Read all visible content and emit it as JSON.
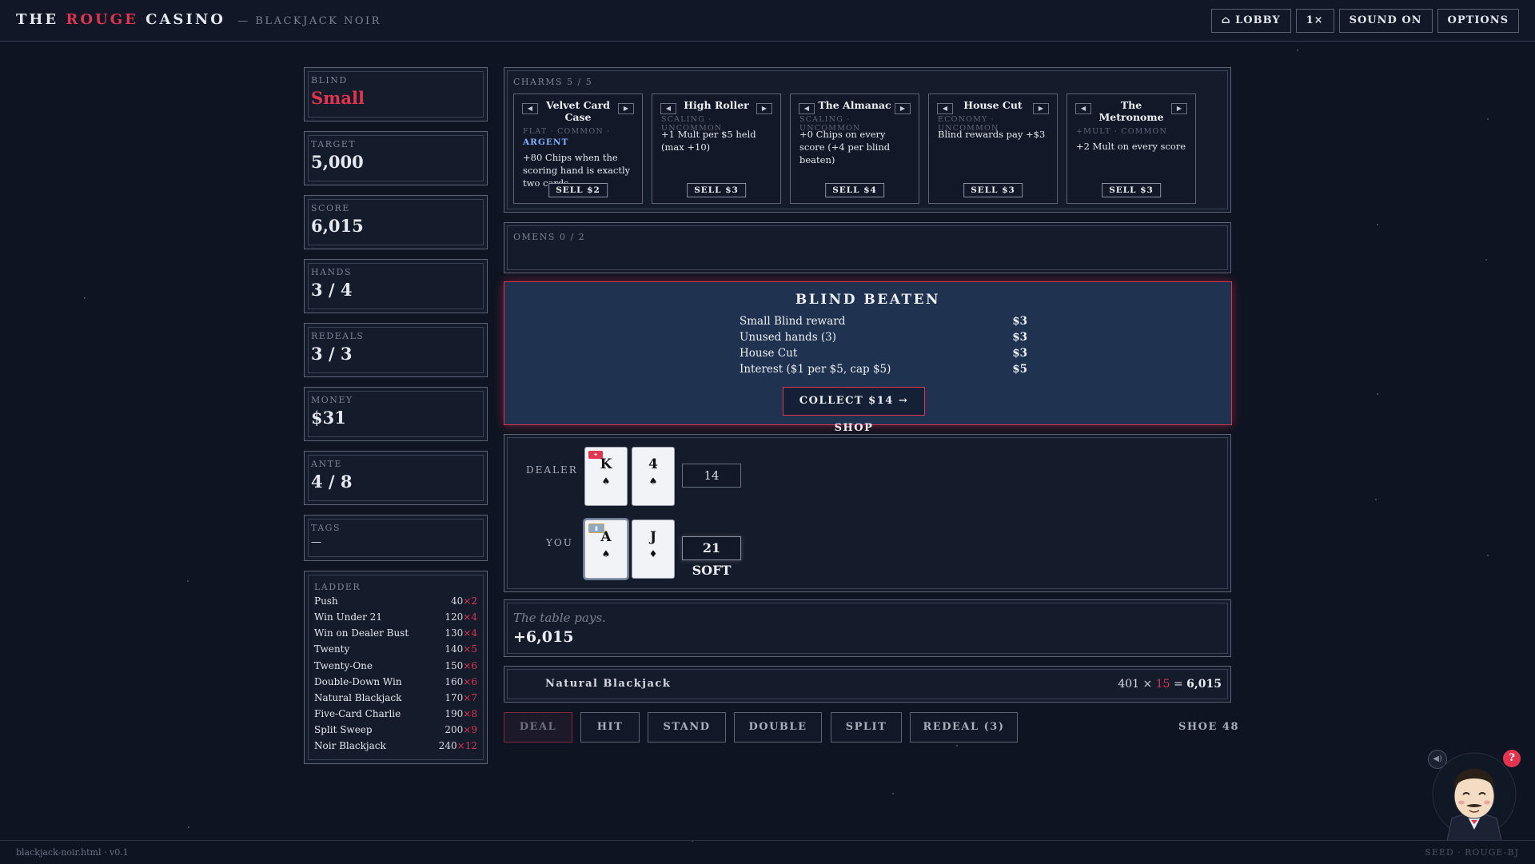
{
  "header": {
    "brand_the": "THE",
    "brand_rouge": "ROUGE",
    "brand_casino": "CASINO",
    "brand_sub": "— BLACKJACK NOIR",
    "buttons": [
      "⌂ LOBBY",
      "1×",
      "SOUND ON",
      "OPTIONS"
    ]
  },
  "stats": [
    {
      "label": "BLIND",
      "value": "Small"
    },
    {
      "label": "TARGET",
      "value": "5,000"
    },
    {
      "label": "SCORE",
      "value": "6,015"
    },
    {
      "label": "HANDS",
      "value": "3 / 4"
    },
    {
      "label": "REDEALS",
      "value": "3 / 3"
    },
    {
      "label": "MONEY",
      "value": "$31"
    },
    {
      "label": "ANTE",
      "value": "4 / 8"
    },
    {
      "label": "TAGS",
      "value": "—"
    }
  ],
  "ladder": {
    "label": "LADDER",
    "rows": [
      {
        "name": "Push",
        "chips": "40",
        "mult": "×2"
      },
      {
        "name": "Win Under 21",
        "chips": "120",
        "mult": "×4"
      },
      {
        "name": "Win on Dealer Bust",
        "chips": "130",
        "mult": "×4"
      },
      {
        "name": "Twenty",
        "chips": "140",
        "mult": "×5"
      },
      {
        "name": "Twenty-One",
        "chips": "150",
        "mult": "×6"
      },
      {
        "name": "Double-Down Win",
        "chips": "160",
        "mult": "×6"
      },
      {
        "name": "Natural Blackjack",
        "chips": "170",
        "mult": "×7"
      },
      {
        "name": "Five-Card Charlie",
        "chips": "190",
        "mult": "×8"
      },
      {
        "name": "Split Sweep",
        "chips": "200",
        "mult": "×9"
      },
      {
        "name": "Noir Blackjack",
        "chips": "240",
        "mult": "×12"
      }
    ]
  },
  "charms": {
    "label": "CHARMS 5 / 5",
    "items": [
      {
        "name": "Velvet Card Case",
        "meta": "FLAT · COMMON ·",
        "tier": "ARGENT",
        "desc": "+80 Chips when the scoring hand is exactly two cards",
        "sell": "SELL $2"
      },
      {
        "name": "High Roller",
        "meta": "SCALING · UNCOMMON",
        "tier": "",
        "desc": "+1 Mult per $5 held (max +10)",
        "sell": "SELL $3"
      },
      {
        "name": "The Almanac",
        "meta": "SCALING · UNCOMMON",
        "tier": "",
        "desc": "+0 Chips on every score (+4 per blind beaten)",
        "sell": "SELL $4"
      },
      {
        "name": "House Cut",
        "meta": "ECONOMY · UNCOMMON",
        "tier": "",
        "desc": "Blind rewards pay +$3",
        "sell": "SELL $3"
      },
      {
        "name": "The Metronome",
        "meta": "+MULT · COMMON",
        "tier": "",
        "desc": "+2 Mult on every score",
        "sell": "SELL $3"
      }
    ]
  },
  "omens": {
    "label": "OMENS 0 / 2"
  },
  "result": {
    "title": "BLIND BEATEN",
    "rows": [
      {
        "label": "Small Blind reward",
        "amount": "$3"
      },
      {
        "label": "Unused hands (3)",
        "amount": "$3"
      },
      {
        "label": "House Cut",
        "amount": "$3"
      },
      {
        "label": "Interest ($1 per $5, cap $5)",
        "amount": "$5"
      }
    ],
    "collect": "COLLECT $14 → SHOP"
  },
  "table": {
    "dealer_label": "DEALER",
    "you_label": "YOU",
    "dealer_cards": [
      {
        "rank": "K",
        "suit": "♠"
      },
      {
        "rank": "4",
        "suit": "♠"
      }
    ],
    "player_cards": [
      {
        "rank": "A",
        "suit": "♠"
      },
      {
        "rank": "J",
        "suit": "♦"
      }
    ],
    "dealer_total": "14",
    "player_total": "21 SOFT"
  },
  "payout": {
    "note": "The table pays.",
    "amount": "+6,015"
  },
  "hand_result": {
    "name": "Natural Blackjack",
    "chips": "401",
    "times": "×",
    "mult": "15",
    "equals": "=",
    "total": "6,015"
  },
  "actions": [
    "DEAL",
    "HIT",
    "STAND",
    "DOUBLE",
    "SPLIT",
    "REDEAL (3)"
  ],
  "shoe": "SHOE 48",
  "help_badge": "?",
  "footer": {
    "version": "blackjack-noir.html · v0.1",
    "seed": "SEED · ROUGE-BJ"
  },
  "colors": {
    "accent": "#e0344f",
    "panel": "#141b2a",
    "background": "#0e1421",
    "banner": "#1f3250"
  }
}
